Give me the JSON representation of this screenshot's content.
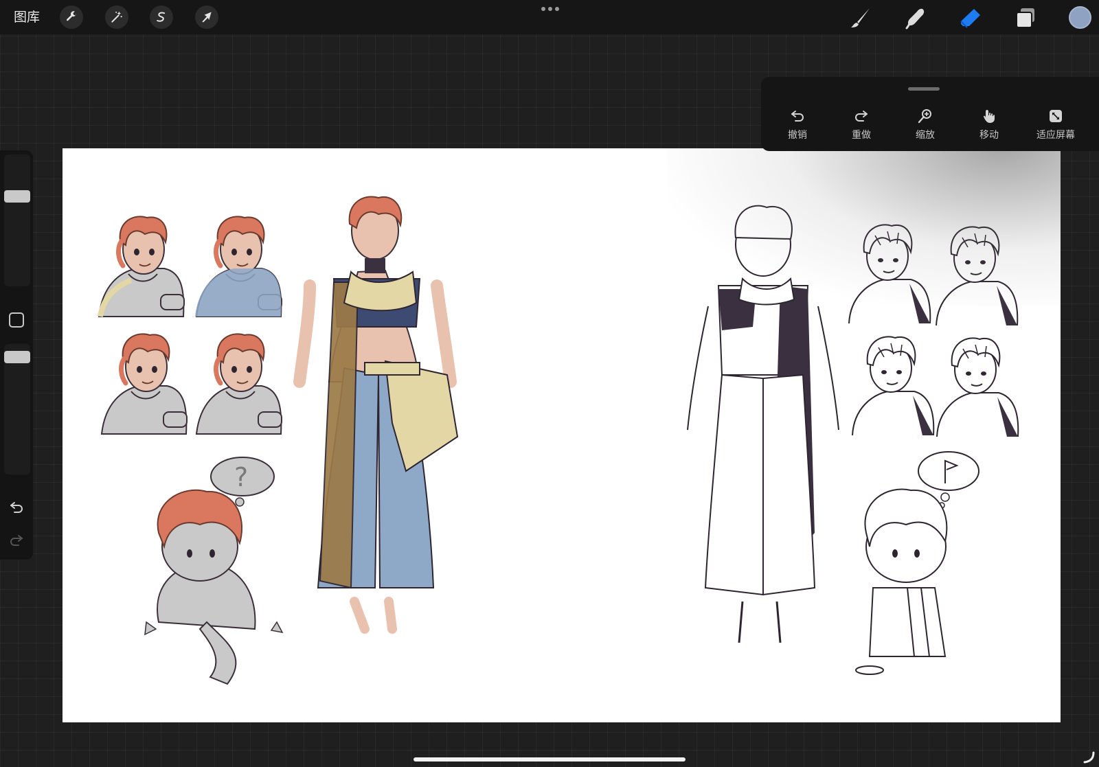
{
  "topbar": {
    "gallery_label": "图库",
    "left_tools": [
      {
        "name": "actions",
        "icon": "wrench-icon"
      },
      {
        "name": "adjustments",
        "icon": "magic-wand-icon"
      },
      {
        "name": "selection",
        "icon": "selection-s-icon"
      },
      {
        "name": "transform",
        "icon": "arrow-cursor-icon"
      }
    ],
    "more_icon": "more-dots-icon",
    "right_tools": [
      {
        "name": "brush",
        "icon": "brush-icon"
      },
      {
        "name": "smudge",
        "icon": "smudge-finger-icon"
      },
      {
        "name": "eraser",
        "icon": "eraser-icon",
        "active": true,
        "active_color": "#1e7cf2"
      },
      {
        "name": "layers",
        "icon": "layers-icon"
      }
    ],
    "current_color": "#8fa2c2"
  },
  "gesture_panel": {
    "items": [
      {
        "label": "撤销",
        "icon": "undo-icon"
      },
      {
        "label": "重做",
        "icon": "redo-icon"
      },
      {
        "label": "缩放",
        "icon": "zoom-icon"
      },
      {
        "label": "移动",
        "icon": "hand-icon"
      },
      {
        "label": "适应屏幕",
        "icon": "fit-screen-icon"
      }
    ]
  },
  "sidebar": {
    "brush_size": 0.7,
    "opacity": 0.94,
    "modify_icon": "square-modify-icon",
    "undo_icon": "undo-icon",
    "redo_icon": "redo-icon"
  },
  "canvas": {
    "background": "#ffffff",
    "colors": {
      "hair": "#d9785e",
      "skin": "#e8c2ae",
      "cloth_blue": "#8ea8c8",
      "cloth_yellow": "#e3d7a6",
      "cloth_brown": "#9c7a47",
      "cloth_gray": "#c9c9c9",
      "ink": "#2e2530"
    }
  }
}
